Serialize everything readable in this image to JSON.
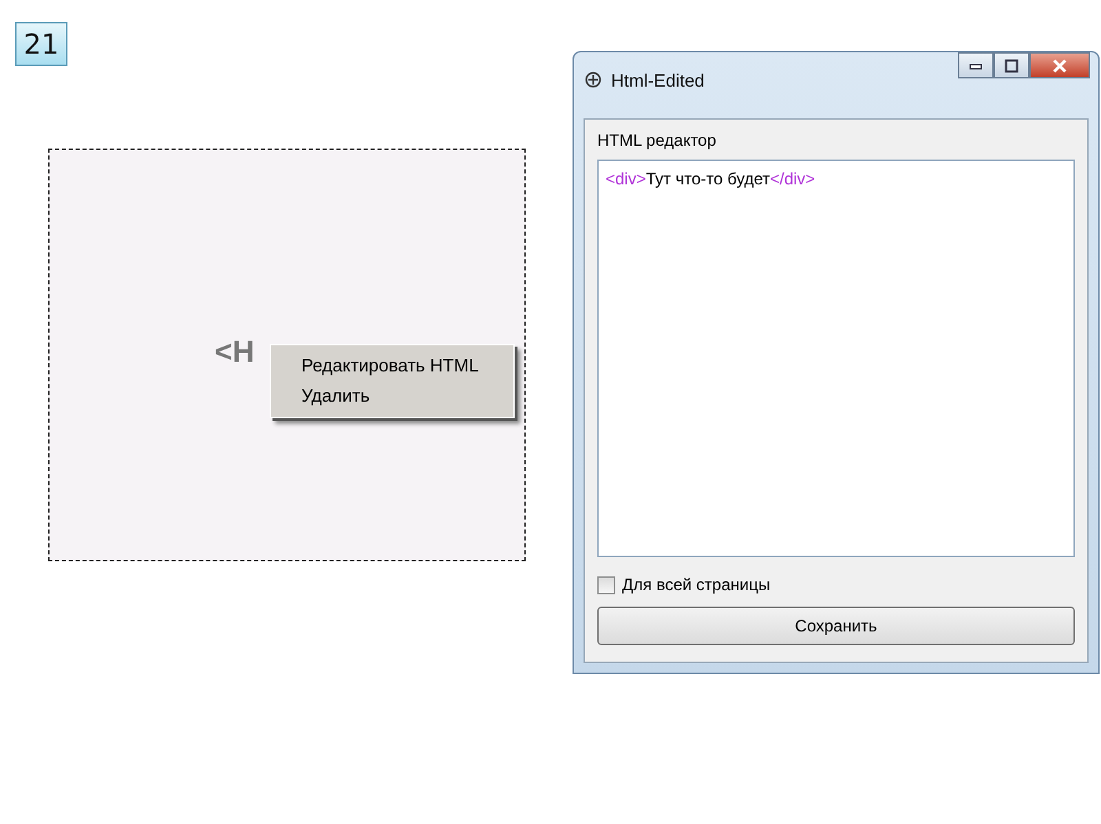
{
  "slide_number": "21",
  "preview": {
    "placeholder_text": "<H",
    "context_menu": [
      {
        "label": "Редактировать HTML"
      },
      {
        "label": "Удалить"
      }
    ]
  },
  "window": {
    "title": "Html-Edited",
    "editor_label": "HTML редактор",
    "code": [
      {
        "kind": "tag",
        "text": "<div>"
      },
      {
        "kind": "text",
        "text": "Тут что-то будет"
      },
      {
        "kind": "tag",
        "text": "</div>"
      }
    ],
    "checkbox": {
      "label": "Для всей страницы",
      "checked": false
    },
    "button": "Сохранить"
  }
}
